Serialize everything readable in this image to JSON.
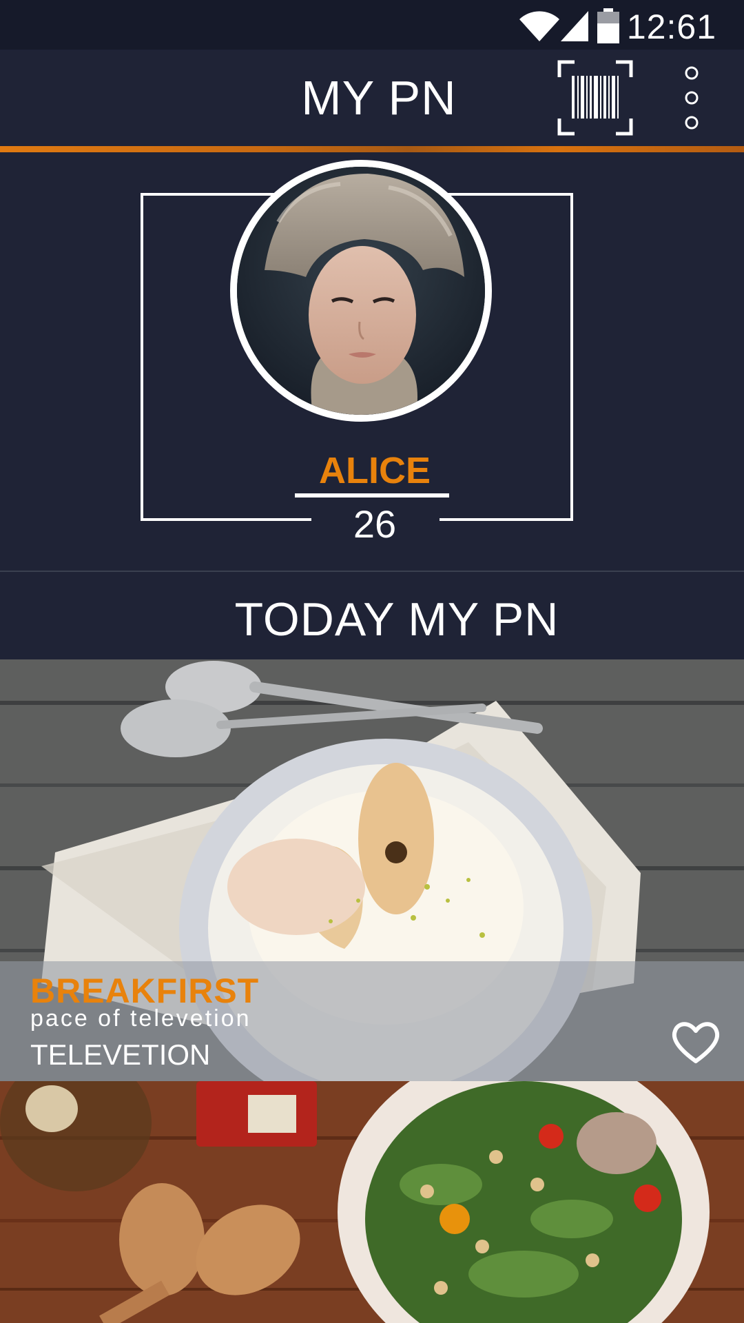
{
  "status_bar": {
    "time": "12:61"
  },
  "app_bar": {
    "title": "MY PN"
  },
  "profile": {
    "name": "ALICE",
    "age": "26"
  },
  "section": {
    "title": "TODAY MY PN"
  },
  "feed": [
    {
      "title": "BREAKFIRST",
      "subtitle": "pace  of televetion",
      "category": "TELEVETION",
      "liked": false
    },
    {
      "title": "",
      "subtitle": "",
      "category": ""
    }
  ],
  "colors": {
    "background": "#1f2336",
    "accent": "#e8820c",
    "status_bar": "#161a2a"
  },
  "icons": [
    "wifi-icon",
    "signal-icon",
    "battery-icon",
    "barcode-scan-icon",
    "more-vert-icon",
    "heart-icon"
  ]
}
